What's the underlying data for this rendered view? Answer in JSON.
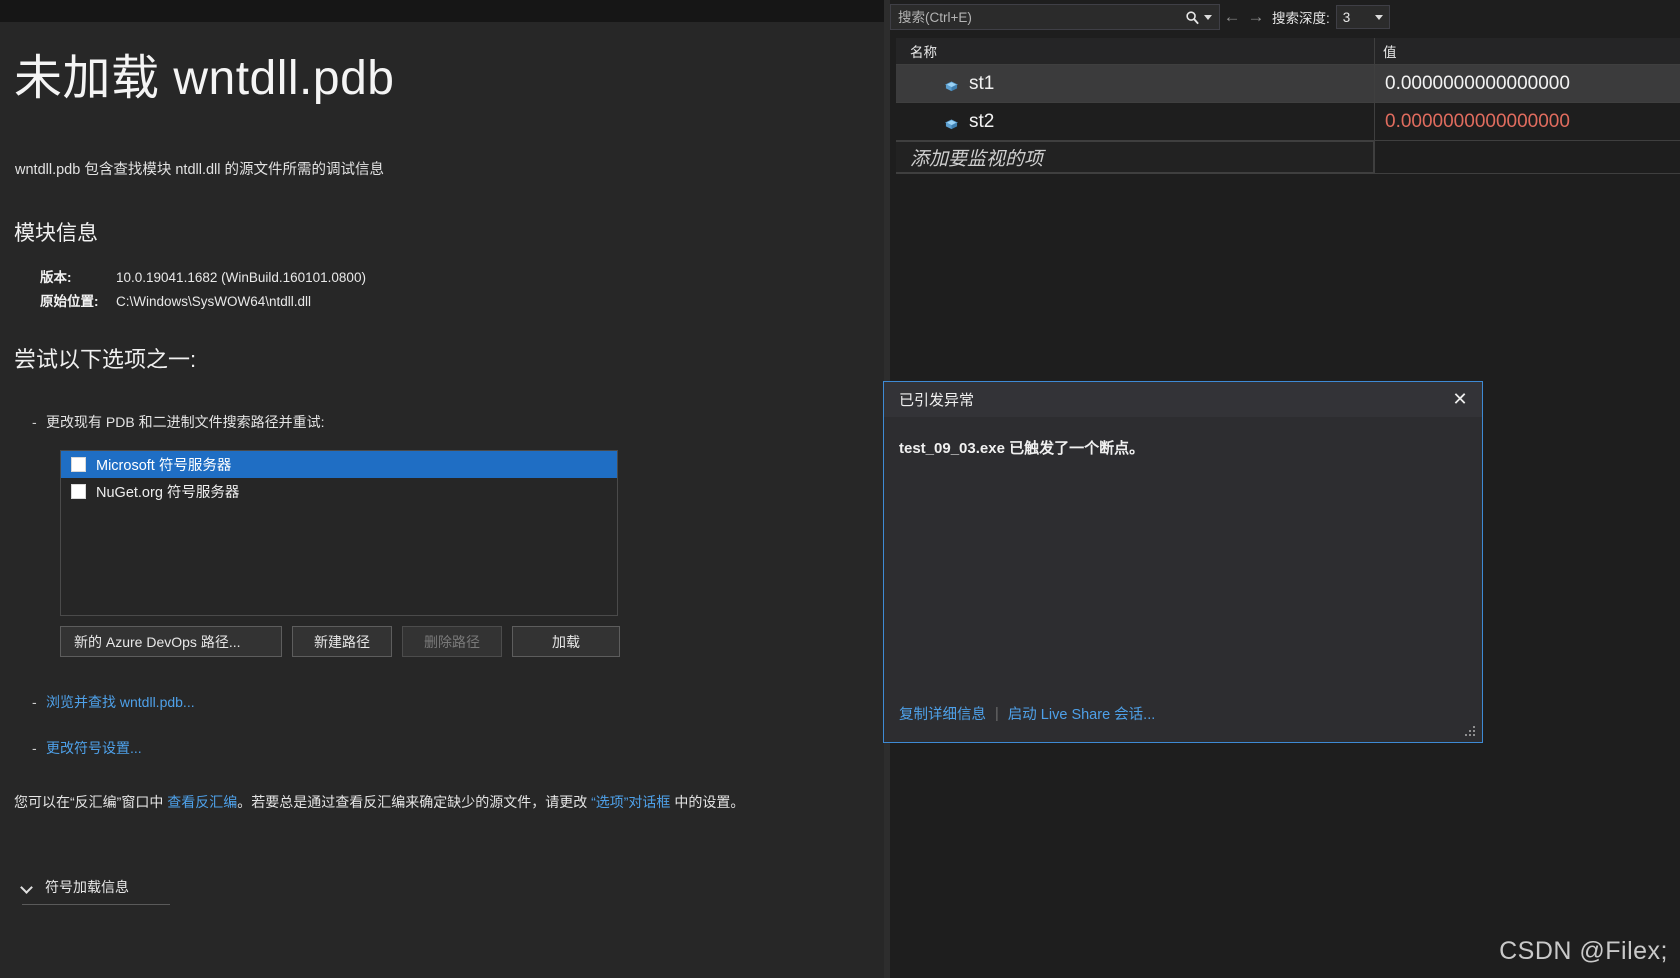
{
  "document": {
    "title": "未加载 wntdll.pdb",
    "intro": "wntdll.pdb 包含查找模块 ntdll.dll 的源文件所需的调试信息",
    "module_section_heading": "模块信息",
    "module_info": {
      "version_label": "版本:",
      "version_value": "10.0.19041.1682 (WinBuild.160101.0800)",
      "location_label": "原始位置:",
      "location_value": "C:\\Windows\\SysWOW64\\ntdll.dll"
    },
    "options_heading": "尝试以下选项之一:",
    "bullets": {
      "change_paths": "更改现有 PDB 和二进制文件搜索路径并重试:",
      "browse_prefix": "浏览并查找 wntdll.pdb...",
      "change_symbol_settings": "更改符号设置..."
    },
    "symbol_servers": [
      {
        "label": "Microsoft 符号服务器",
        "checked": false,
        "selected": true
      },
      {
        "label": "NuGet.org 符号服务器",
        "checked": false,
        "selected": false
      }
    ],
    "buttons": [
      {
        "label": "新的 Azure DevOps 路径...",
        "disabled": false
      },
      {
        "label": "新建路径",
        "disabled": false
      },
      {
        "label": "删除路径",
        "disabled": true
      },
      {
        "label": "加载",
        "disabled": false
      }
    ],
    "disassembly_paragraph": {
      "part1": "您可以在“反汇编”窗口中 ",
      "link1": "查看反汇编",
      "part2": "。若要总是通过查看反汇编来确定缺少的源文件，请更改 ",
      "link2": "“选项”对话框",
      "part3": " 中的设置。"
    },
    "expander_label": "符号加载信息",
    "icons": {
      "chevron": "chevron-down-icon"
    }
  },
  "watch": {
    "search": {
      "placeholder": "搜索(Ctrl+E)",
      "value": "",
      "magnifier_icon": "search-icon",
      "dropdown_icon": "chevron-down-icon",
      "back_icon": "arrow-left-icon",
      "forward_icon": "arrow-right-icon",
      "back_glyph": "←",
      "forward_glyph": "→",
      "depth_label": "搜索深度:",
      "depth_value": "3"
    },
    "columns": {
      "name": "名称",
      "value": "值"
    },
    "rows": [
      {
        "name": "st1",
        "value": "0.0000000000000000",
        "selected": true,
        "changed": false,
        "icon": "field-box-icon"
      },
      {
        "name": "st2",
        "value": "0.0000000000000000",
        "selected": false,
        "changed": true,
        "icon": "field-box-icon"
      }
    ],
    "add_row_placeholder": "添加要监视的项"
  },
  "dialog": {
    "title": "已引发异常",
    "close_label": "✕",
    "message": "test_09_03.exe 已触发了一个断点。",
    "footer": {
      "copy_details": "复制详细信息",
      "separator": "|",
      "live_share": "启动 Live Share 会话..."
    }
  },
  "watermark": "CSDN @Filex;",
  "colors": {
    "accent_blue": "#1f6ec4",
    "link_blue": "#4ea0e8",
    "dialog_border": "#3e8ad4",
    "changed_value": "#e06c5e",
    "panel_bg": "#272727",
    "watch_bg": "#1e1e1e"
  }
}
